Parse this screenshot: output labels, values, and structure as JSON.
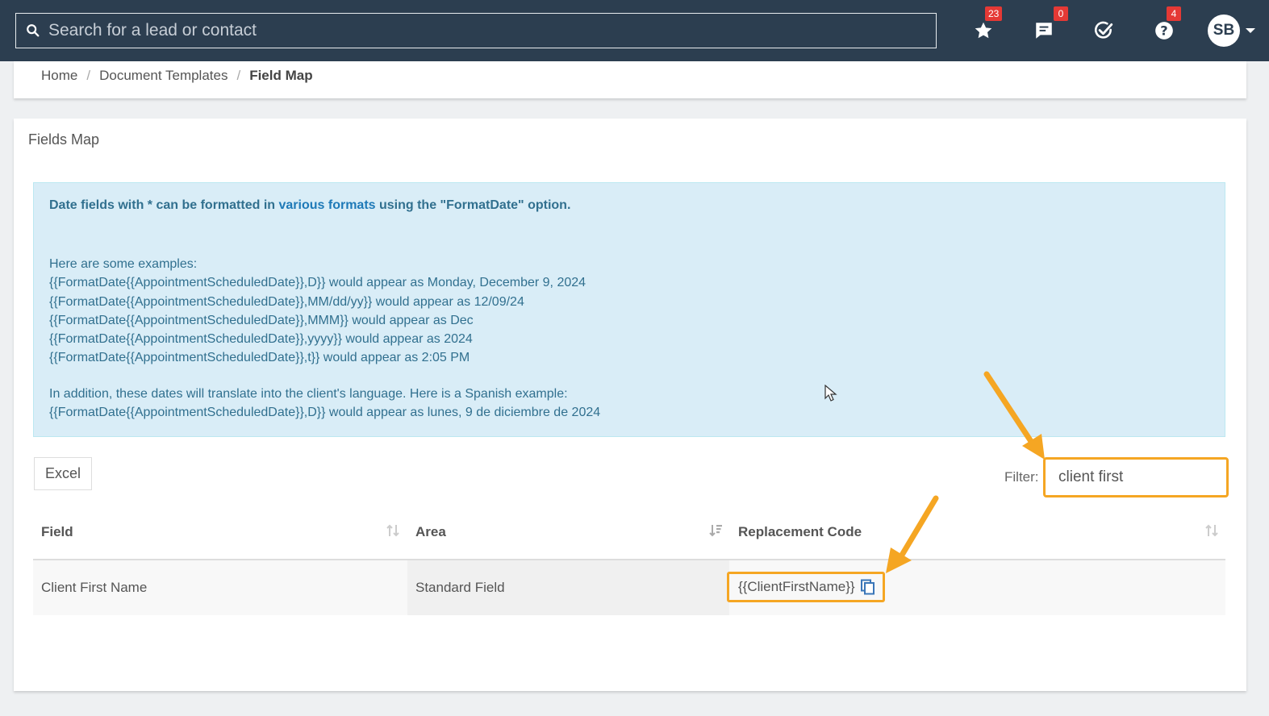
{
  "topbar": {
    "search_placeholder": "Search for a lead or contact",
    "icons": [
      {
        "name": "star-icon",
        "badge": "23"
      },
      {
        "name": "chat-icon",
        "badge": "0"
      },
      {
        "name": "check-circle-icon",
        "badge": ""
      },
      {
        "name": "help-icon",
        "badge": "4"
      }
    ],
    "avatar_initials": "SB"
  },
  "breadcrumb": {
    "home": "Home",
    "templates": "Document Templates",
    "current": "Field Map"
  },
  "card": {
    "title": "Fields Map"
  },
  "alert": {
    "head_pre": "Date fields with * can be formatted in ",
    "head_link": "various formats",
    "head_post": " using the \"FormatDate\" option.",
    "intro": "Here are some examples:",
    "examples": [
      "{{FormatDate{{AppointmentScheduledDate}},D}} would appear as Monday, December 9, 2024",
      "{{FormatDate{{AppointmentScheduledDate}},MM/dd/yy}} would appear as 12/09/24",
      "{{FormatDate{{AppointmentScheduledDate}},MMM}} would appear as Dec",
      "{{FormatDate{{AppointmentScheduledDate}},yyyy}} would appear as 2024",
      "{{FormatDate{{AppointmentScheduledDate}},t}} would appear as 2:05 PM"
    ],
    "language_note": "In addition, these dates will translate into the client's language. Here is a Spanish example:",
    "spanish_example": "{{FormatDate{{AppointmentScheduledDate}},D}} would appear as lunes, 9 de diciembre de 2024"
  },
  "toolbar": {
    "excel_label": "Excel",
    "filter_label": "Filter:",
    "filter_value": "client first"
  },
  "table": {
    "headers": [
      "Field",
      "Area",
      "Replacement Code"
    ],
    "rows": [
      {
        "field": "Client First Name",
        "area": "Standard Field",
        "code": "{{ClientFirstName}}"
      }
    ]
  },
  "colors": {
    "nav_bg": "#2c3e50",
    "highlight": "#f5a623",
    "alert_bg": "#d9edf7",
    "badge": "#e53935"
  }
}
